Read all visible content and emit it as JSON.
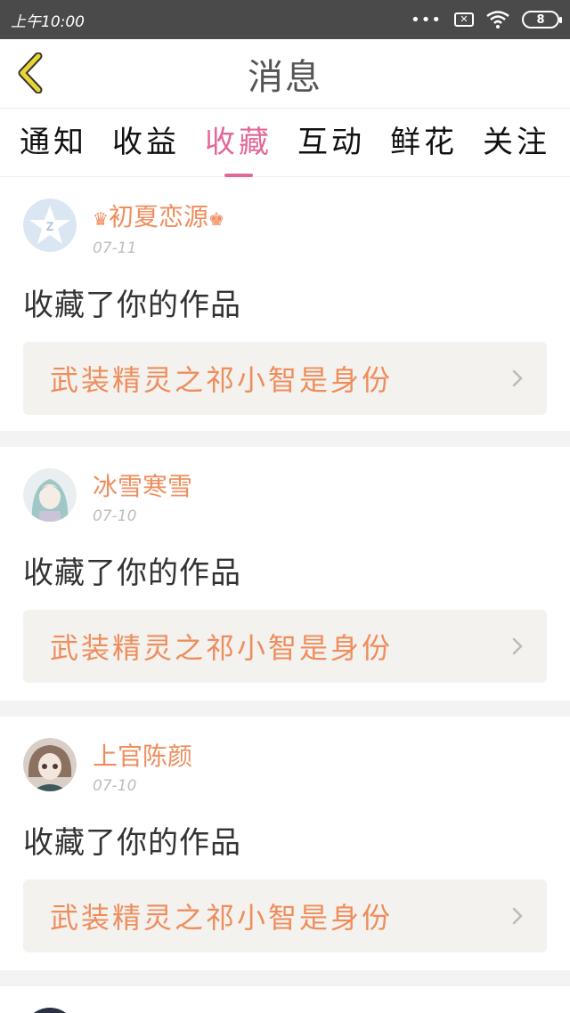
{
  "status_bar": {
    "time": "上午10:00",
    "battery": "8"
  },
  "header": {
    "title": "消息"
  },
  "tabs": [
    {
      "label": "通知"
    },
    {
      "label": "收益"
    },
    {
      "label": "收藏"
    },
    {
      "label": "互动"
    },
    {
      "label": "鲜花"
    },
    {
      "label": "关注"
    }
  ],
  "active_tab": "收藏",
  "messages": [
    {
      "user": "初夏恋源",
      "date": "07-11",
      "action": "收藏了你的作品",
      "work": "武装精灵之祁小智是身份"
    },
    {
      "user": "冰雪寒雪",
      "date": "07-10",
      "action": "收藏了你的作品",
      "work": "武装精灵之祁小智是身份"
    },
    {
      "user": "上官陈颜",
      "date": "07-10",
      "action": "收藏了你的作品",
      "work": "武装精灵之祁小智是身份"
    }
  ],
  "colors": {
    "accent": "#e2689a",
    "name": "#ef8d5d",
    "back": "#e9d633"
  }
}
